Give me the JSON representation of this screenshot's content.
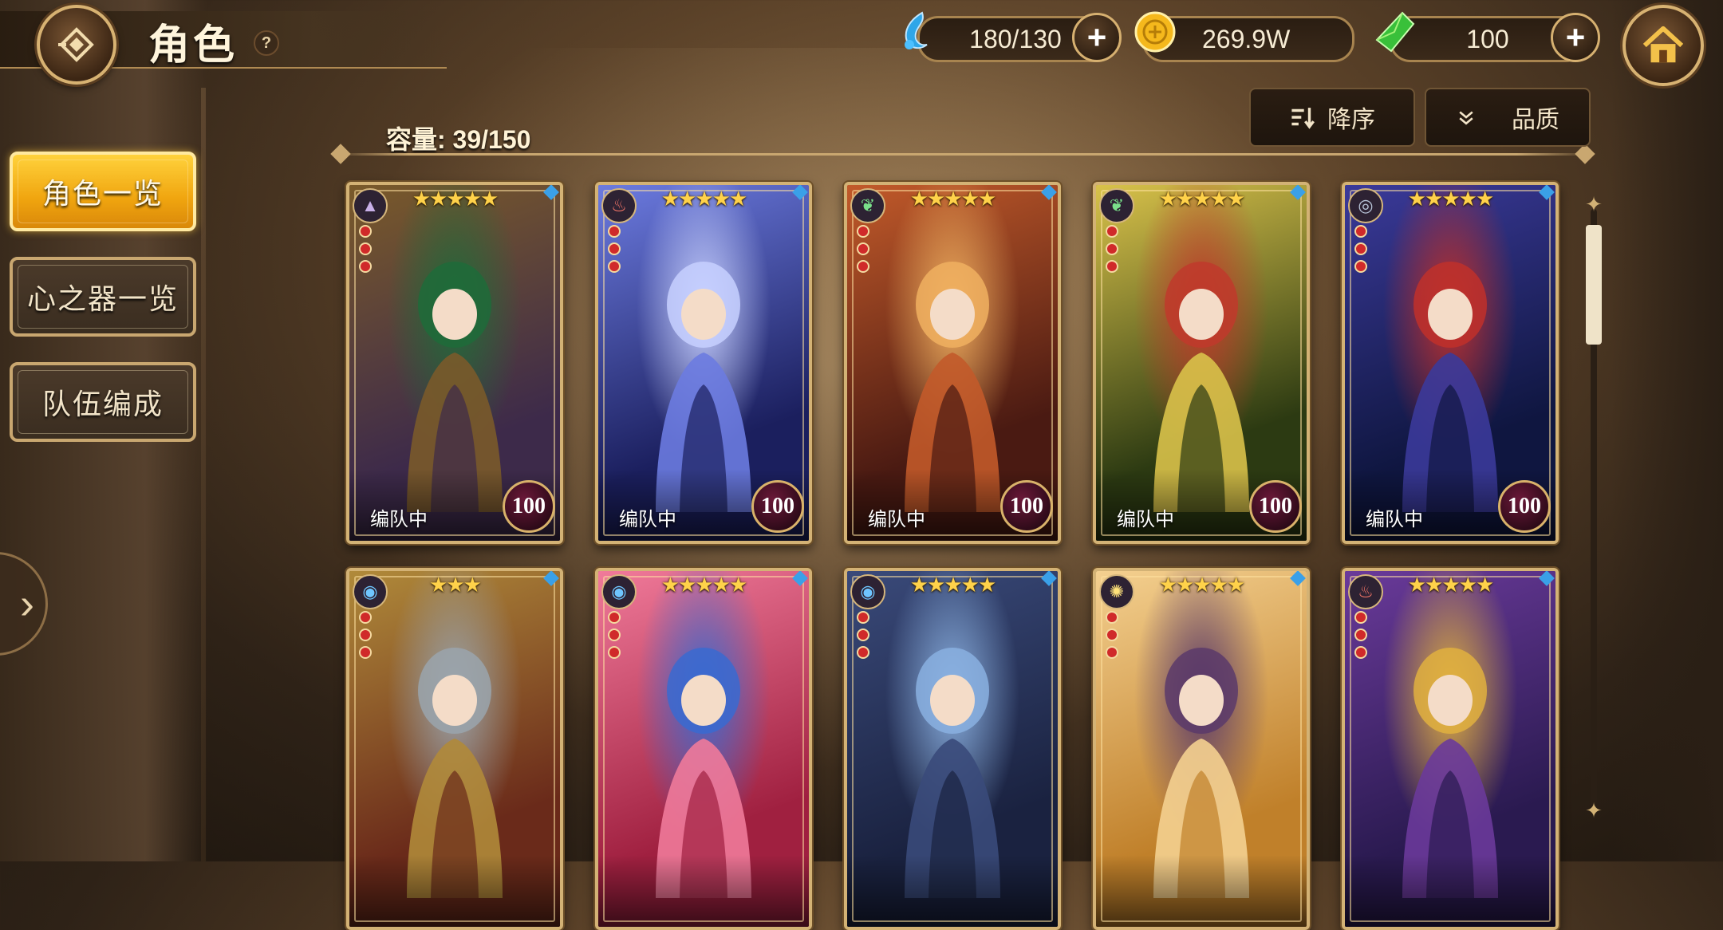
{
  "header": {
    "title": "角色",
    "help_label": "?",
    "resources": [
      {
        "icon": "water-drop-icon",
        "value": "180/130",
        "has_plus": true
      },
      {
        "icon": "gold-coin-icon",
        "value": "269.9W",
        "has_plus": false
      },
      {
        "icon": "green-crystal-icon",
        "value": "100",
        "has_plus": true
      }
    ]
  },
  "sidebar": {
    "items": [
      {
        "label": "角色一览",
        "active": true
      },
      {
        "label": "心之器一览",
        "active": false
      },
      {
        "label": "队伍编成",
        "active": false
      }
    ]
  },
  "toolbar": {
    "capacity_label": "容量: 39/150",
    "sort_label": "降序",
    "filter_label": "品质"
  },
  "cards": [
    {
      "element": "wind",
      "stars": "★★★★★",
      "status": "编队中",
      "level": "100",
      "palette": [
        "#3d2a4a",
        "#7a5a2a",
        "#1f6b3a"
      ]
    },
    {
      "element": "fire",
      "stars": "★★★★★",
      "status": "编队中",
      "level": "100",
      "palette": [
        "#1b1f5e",
        "#6c7be0",
        "#c7d0ff"
      ]
    },
    {
      "element": "leaf",
      "stars": "★★★★★",
      "status": "编队中",
      "level": "100",
      "palette": [
        "#4a1a12",
        "#c25a2a",
        "#f0b060"
      ]
    },
    {
      "element": "leaf",
      "stars": "★★★★★",
      "status": "编队中",
      "level": "100",
      "palette": [
        "#2c3a12",
        "#d9c24a",
        "#c0392b"
      ]
    },
    {
      "element": "dark",
      "stars": "★★★★★",
      "status": "编队中",
      "level": "100",
      "palette": [
        "#0f1640",
        "#3b3a9a",
        "#c0302a"
      ]
    },
    {
      "element": "water",
      "stars": "★★★",
      "status": "",
      "level": "",
      "palette": [
        "#6a2a1a",
        "#b08a3a",
        "#9aa4ad"
      ]
    },
    {
      "element": "water",
      "stars": "★★★★★",
      "status": "",
      "level": "",
      "palette": [
        "#a02040",
        "#f07a9a",
        "#3a6ad0"
      ]
    },
    {
      "element": "water",
      "stars": "★★★★★",
      "status": "",
      "level": "",
      "palette": [
        "#1a2240",
        "#3a4a7a",
        "#8ab0e0"
      ]
    },
    {
      "element": "light",
      "stars": "★★★★★",
      "status": "",
      "level": "",
      "palette": [
        "#c0802a",
        "#f4d090",
        "#5a3a6a"
      ]
    },
    {
      "element": "fire",
      "stars": "★★★★★",
      "status": "",
      "level": "",
      "palette": [
        "#2a1a50",
        "#6a3a9a",
        "#e0b040"
      ]
    }
  ]
}
